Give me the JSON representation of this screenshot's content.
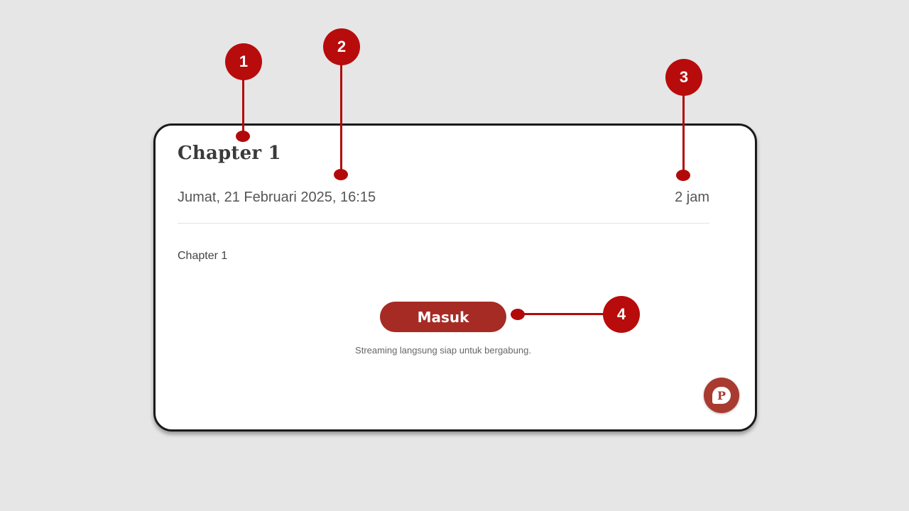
{
  "card": {
    "title": "Chapter 1",
    "datetime": "Jumat, 21 Februari 2025, 16:15",
    "duration": "2 jam",
    "description": "Chapter 1",
    "enter_button_label": "Masuk",
    "stream_note": "Streaming langsung siap untuk bergabung."
  },
  "chat_fab": {
    "icon": "chat-bubble-p-icon",
    "glyph": "P"
  },
  "annotations": {
    "badge_1": "1",
    "badge_2": "2",
    "badge_3": "3",
    "badge_4": "4"
  },
  "colors": {
    "accent": "#a62b24",
    "annotation": "#b80b0b",
    "background": "#e6e6e6"
  }
}
